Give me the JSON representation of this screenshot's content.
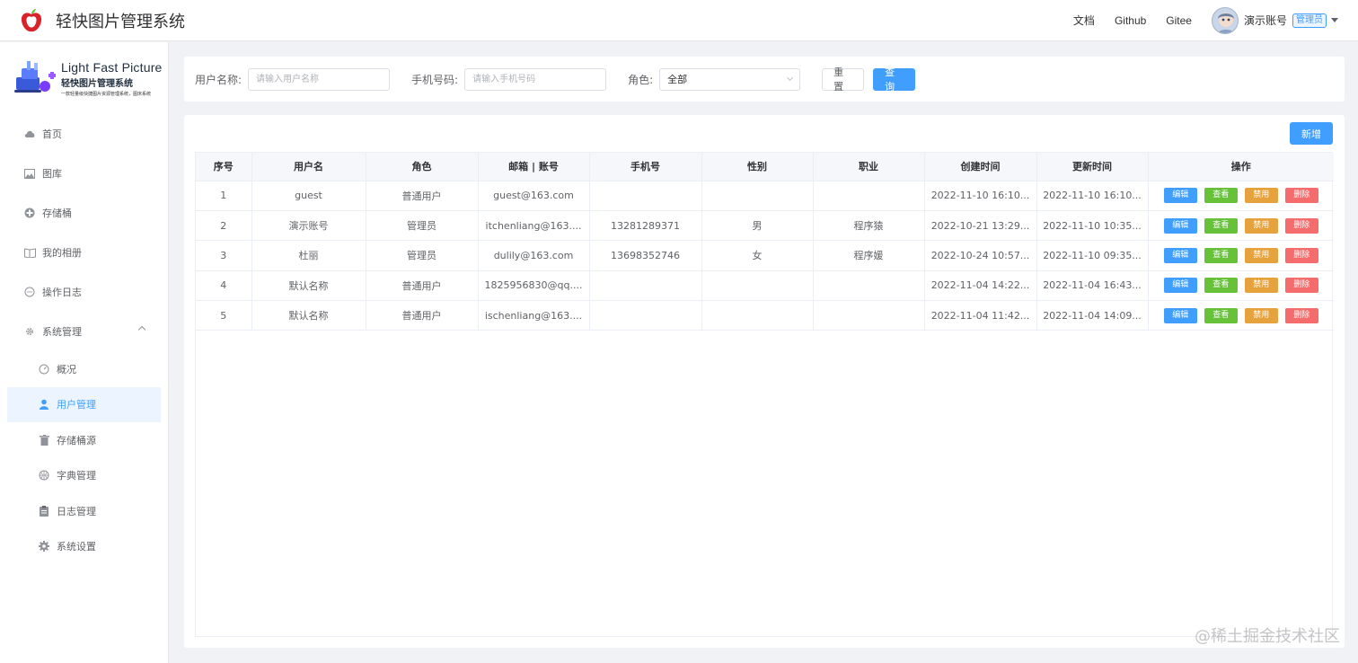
{
  "header": {
    "title": "轻快图片管理系统",
    "links": [
      "文档",
      "Github",
      "Gitee"
    ],
    "user_name": "演示账号",
    "role_tag": "管理员"
  },
  "sidebar": {
    "brand_en": "Light Fast Picture",
    "brand_cn": "轻快图片管理系统",
    "brand_sub": "一款轻量级快捷图片资源管理系统，图床系统",
    "items": [
      {
        "label": "首页",
        "icon": "cloud-icon"
      },
      {
        "label": "图库",
        "icon": "picture-icon"
      },
      {
        "label": "存储桶",
        "icon": "bucket-icon"
      },
      {
        "label": "我的相册",
        "icon": "book-icon"
      },
      {
        "label": "操作日志",
        "icon": "chat-icon"
      },
      {
        "label": "系统管理",
        "icon": "gear-icon"
      }
    ],
    "sub_items": [
      {
        "label": "概况",
        "icon": "dashboard-icon"
      },
      {
        "label": "用户管理",
        "icon": "user-icon",
        "active": true
      },
      {
        "label": "存储桶源",
        "icon": "trash-icon"
      },
      {
        "label": "字典管理",
        "icon": "basketball-icon"
      },
      {
        "label": "日志管理",
        "icon": "clipboard-icon"
      },
      {
        "label": "系统设置",
        "icon": "settings-icon"
      }
    ]
  },
  "search": {
    "username_label": "用户名称:",
    "username_placeholder": "请输入用户名称",
    "phone_label": "手机号码:",
    "phone_placeholder": "请输入手机号码",
    "role_label": "角色:",
    "role_value": "全部",
    "reset_label": "重置",
    "query_label": "查询"
  },
  "table": {
    "add_label": "新增",
    "columns": [
      "序号",
      "用户名",
      "角色",
      "邮箱 | 账号",
      "手机号",
      "性别",
      "职业",
      "创建时间",
      "更新时间",
      "操作"
    ],
    "actions": [
      "编辑",
      "查看",
      "禁用",
      "删除"
    ],
    "rows": [
      {
        "index": "1",
        "username": "guest",
        "role": "普通用户",
        "email": "guest@163.com",
        "phone": "",
        "gender": "",
        "job": "",
        "created": "2022-11-10 16:10...",
        "updated": "2022-11-10 16:10..."
      },
      {
        "index": "2",
        "username": "演示账号",
        "role": "管理员",
        "email": "itchenliang@163....",
        "phone": "13281289371",
        "gender": "男",
        "job": "程序猿",
        "created": "2022-10-21 13:29...",
        "updated": "2022-11-10 10:35..."
      },
      {
        "index": "3",
        "username": "杜丽",
        "role": "管理员",
        "email": "dulily@163.com",
        "phone": "13698352746",
        "gender": "女",
        "job": "程序媛",
        "created": "2022-10-24 10:57...",
        "updated": "2022-11-10 09:35..."
      },
      {
        "index": "4",
        "username": "默认名称",
        "role": "普通用户",
        "email": "1825956830@qq....",
        "phone": "",
        "gender": "",
        "job": "",
        "created": "2022-11-04 14:22...",
        "updated": "2022-11-04 16:43..."
      },
      {
        "index": "5",
        "username": "默认名称",
        "role": "普通用户",
        "email": "ischenliang@163....",
        "phone": "",
        "gender": "",
        "job": "",
        "created": "2022-11-04 11:42...",
        "updated": "2022-11-04 14:09..."
      }
    ]
  },
  "watermark": "@稀土掘金技术社区",
  "colors": {
    "primary": "#409eff",
    "success": "#67c23a",
    "warning": "#e6a23c",
    "danger": "#f56c6c"
  }
}
